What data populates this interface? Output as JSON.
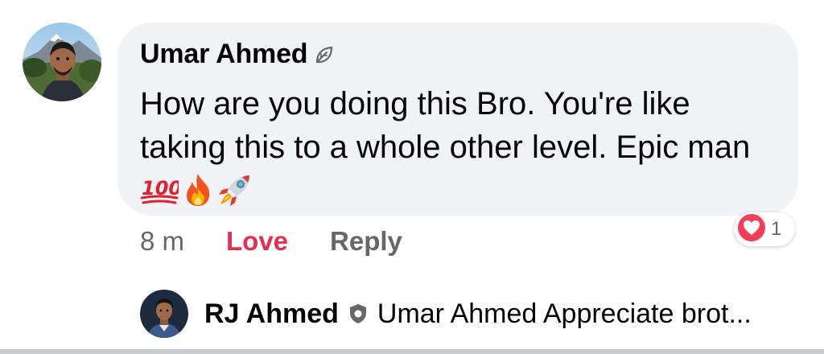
{
  "comment": {
    "author": "Umar Ahmed",
    "author_badge_icon": "leaf-badge-icon",
    "text": "How are you doing this Bro. You're like taking this to a whole other level. Epic man",
    "emojis": [
      "hundred-points-icon",
      "fire-icon",
      "rocket-icon"
    ],
    "time": "8 m",
    "love_label": "Love",
    "reply_label": "Reply",
    "reaction": {
      "icon": "heart-reaction-icon",
      "count": "1"
    }
  },
  "reply_preview": {
    "author": "RJ Ahmed",
    "author_badge_icon": "shield-badge-icon",
    "text": "Umar Ahmed Appreciate brot..."
  },
  "colors": {
    "bubble": "#f0f2f5",
    "love": "#e4304f",
    "secondary_text": "#65676b",
    "primary_text": "#050505",
    "heart": "#f33e58"
  }
}
